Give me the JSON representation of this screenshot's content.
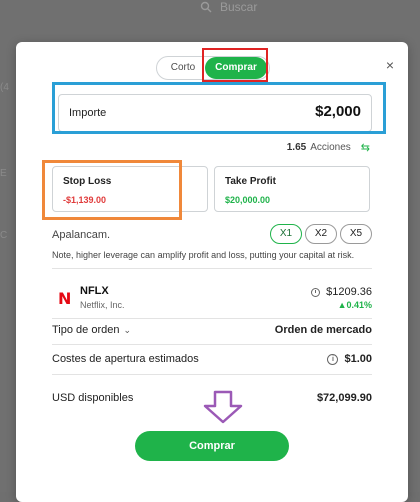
{
  "background": {
    "search_label": "Buscar",
    "fragments": [
      "(4",
      "E",
      "C"
    ]
  },
  "modal": {
    "toggle": {
      "short_label": "Corto",
      "buy_label": "Comprar"
    },
    "amount": {
      "label": "Importe",
      "value": "$2,000"
    },
    "shares": {
      "value": "1.65",
      "label": "Acciones"
    },
    "stop_loss": {
      "title": "Stop Loss",
      "value": "-$1,139.00"
    },
    "take_profit": {
      "title": "Take Profit",
      "value": "$20,000.00"
    },
    "leverage": {
      "label": "Apalancam.",
      "options": [
        "X1",
        "X2",
        "X5"
      ],
      "selected": "X1"
    },
    "note": "Note, higher leverage can amplify profit and loss, putting your capital at risk.",
    "stock": {
      "logo": "N",
      "ticker": "NFLX",
      "company": "Netflix, Inc.",
      "price": "$1209.36",
      "change": "▲0.41%"
    },
    "order_type": {
      "label": "Tipo de orden",
      "value": "Orden de mercado"
    },
    "opening_costs": {
      "label": "Costes de apertura estimados",
      "value": "$1.00"
    },
    "usd_available": {
      "label": "USD disponibles",
      "value": "$72,099.90"
    },
    "buy_button": "Comprar",
    "close_label": "×",
    "info_glyph": "i"
  },
  "colors": {
    "accent_green": "#1fb34a",
    "loss_red": "#e03b3b",
    "annot_red": "#e02424",
    "annot_blue": "#2a9fd6",
    "annot_orange": "#f0883a",
    "annot_purple": "#9b59b6"
  }
}
